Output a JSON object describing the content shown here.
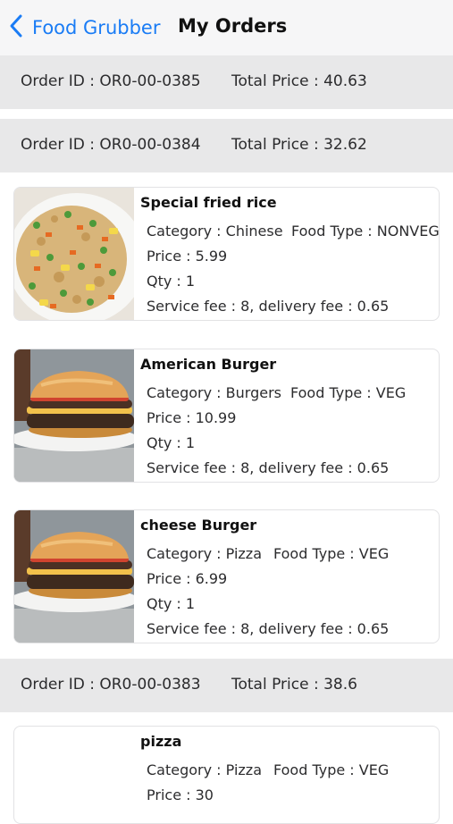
{
  "nav": {
    "back_label": "Food Grubber",
    "title": "My Orders",
    "accent": "#1a7cf5"
  },
  "orders": [
    {
      "order_id": "Order ID : OR0-00-0385",
      "total": "Total Price : 40.63",
      "items": []
    },
    {
      "order_id": "Order ID : OR0-00-0384",
      "total": "Total Price : 32.62",
      "items": [
        {
          "name": "Special fried rice",
          "category": "Category : Chinese",
          "food_type": "Food Type : NONVEG",
          "price": "Price : 5.99",
          "qty": "Qty : 1",
          "fees": "Service fee : 8, delivery fee : 0.65",
          "image": "fried-rice"
        },
        {
          "name": "American Burger",
          "category": "Category : Burgers",
          "food_type": "Food Type : VEG",
          "price": "Price : 10.99",
          "qty": "Qty : 1",
          "fees": "Service fee : 8, delivery fee : 0.65",
          "image": "burger"
        },
        {
          "name": "cheese Burger",
          "category": "Category : Pizza",
          "food_type": "Food Type : VEG",
          "price": "Price : 6.99",
          "qty": "Qty : 1",
          "fees": "Service fee : 8, delivery fee : 0.65",
          "image": "burger"
        }
      ]
    },
    {
      "order_id": "Order ID : OR0-00-0383",
      "total": "Total Price : 38.6",
      "items": [
        {
          "name": "pizza",
          "category": "Category : Pizza",
          "food_type": "Food Type : VEG",
          "price": "Price : 30",
          "image": "none"
        }
      ]
    }
  ]
}
